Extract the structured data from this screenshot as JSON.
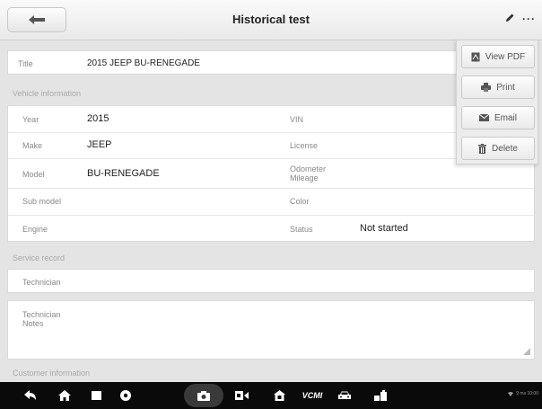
{
  "header": {
    "title": "Historical test"
  },
  "menu": {
    "view_pdf": "View PDF",
    "print": "Print",
    "email": "Email",
    "delete": "Delete"
  },
  "title_row": {
    "label": "Title",
    "value": "2015 JEEP BU-RENEGADE"
  },
  "vehicle": {
    "section": "Vehicle information",
    "year_label": "Year",
    "year": "2015",
    "make_label": "Make",
    "make": "JEEP",
    "model_label": "Model",
    "model": "BU-RENEGADE",
    "submodel_label": "Sub model",
    "engine_label": "Engine",
    "vin_label": "VIN",
    "license_label": "License",
    "odometer_label": "Odometer Mileage",
    "color_label": "Color",
    "status_label": "Status",
    "status": "Not started"
  },
  "service": {
    "section": "Service record",
    "technician_label": "Technician",
    "notes_label": "Technician Notes"
  },
  "customer": {
    "section": "Customer information"
  },
  "navbar": {
    "vcmi_label": "VCMI",
    "status_text": "9 ms  10:00"
  }
}
